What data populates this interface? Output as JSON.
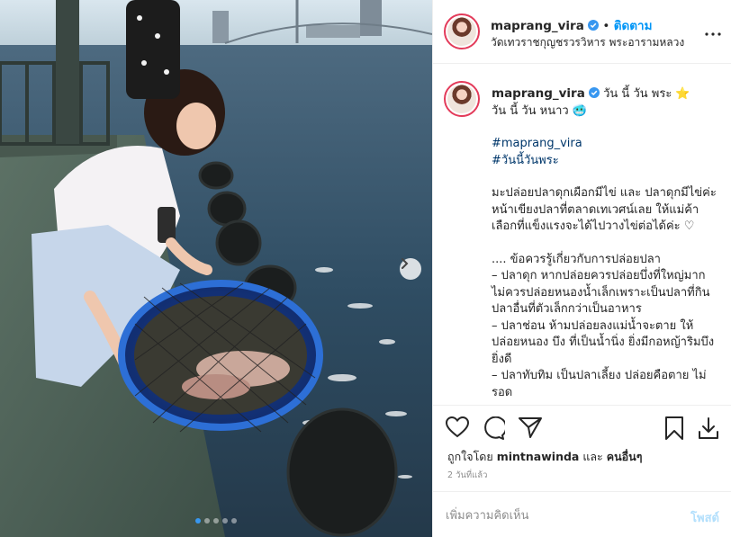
{
  "post": {
    "username": "maprang_vira",
    "follow_label": "ติดตาม",
    "separator": "•",
    "location": "วัดเทวราชกุญชรวรวิหาร พระอารามหลวง",
    "more_icon": "more-horizontal-icon"
  },
  "caption": {
    "username": "maprang_vira",
    "line1": "วัน นี้ วัน พระ ⭐",
    "line2": "วัน นี้ วัน หนาว 🥶",
    "hashtags": [
      "#maprang_vira",
      "#วันนี้วันพระ"
    ],
    "para1": "มะปล่อยปลาดุกเผือกมีไข่ และ ปลาดุกมีไข่ค่ะ หน้าเขียงปลาที่ตลาดเทเวศน์เลย ให้แม่ค้าเลือกที่แข็งแรงจะได้ไปวางไข่ต่อได้ค่ะ ♡",
    "para2_lines": [
      ".... ข้อควรรู้เกี่ยวกับการปล่อยปลา",
      "– ปลาดุก หากปล่อยควรปล่อยบึ่งที่ใหญ่มาก ไม่ควรปล่อยหนองน้ำเล็กเพราะเป็นปลาที่กินปลาอื่นที่ตัวเล็กกว่าเป็นอาหาร",
      "– ปลาช่อน ห้ามปล่อยลงแม่น้ำจะตาย ให้ปล่อยหนอง บึง ที่เป็นน้ำนิ่ง ยิ่งมีกอหญ้าริมบึงยิ่งดี",
      "– ปลาทับทิม เป็นปลาเลี้ยง ปล่อยคือตาย ไม่รอด"
    ]
  },
  "actions": {
    "like_icon": "heart-icon",
    "comment_icon": "comment-icon",
    "share_icon": "send-icon",
    "save_icon": "bookmark-icon",
    "download_icon": "download-icon"
  },
  "likes": {
    "prefix": "ถูกใจโดย",
    "user": "mintnawinda",
    "and": "และ",
    "others": "คนอื่นๆ"
  },
  "time_ago": "2 วันที่แล้ว",
  "comment": {
    "placeholder": "เพิ่มความคิดเห็น",
    "post_label": "โพสต์"
  },
  "carousel": {
    "total": 5,
    "active_index": 0
  },
  "colors": {
    "accent": "#0095f6",
    "verified": "#3897f0",
    "hashtag": "#00376b",
    "post_disabled": "#b2dffc"
  }
}
